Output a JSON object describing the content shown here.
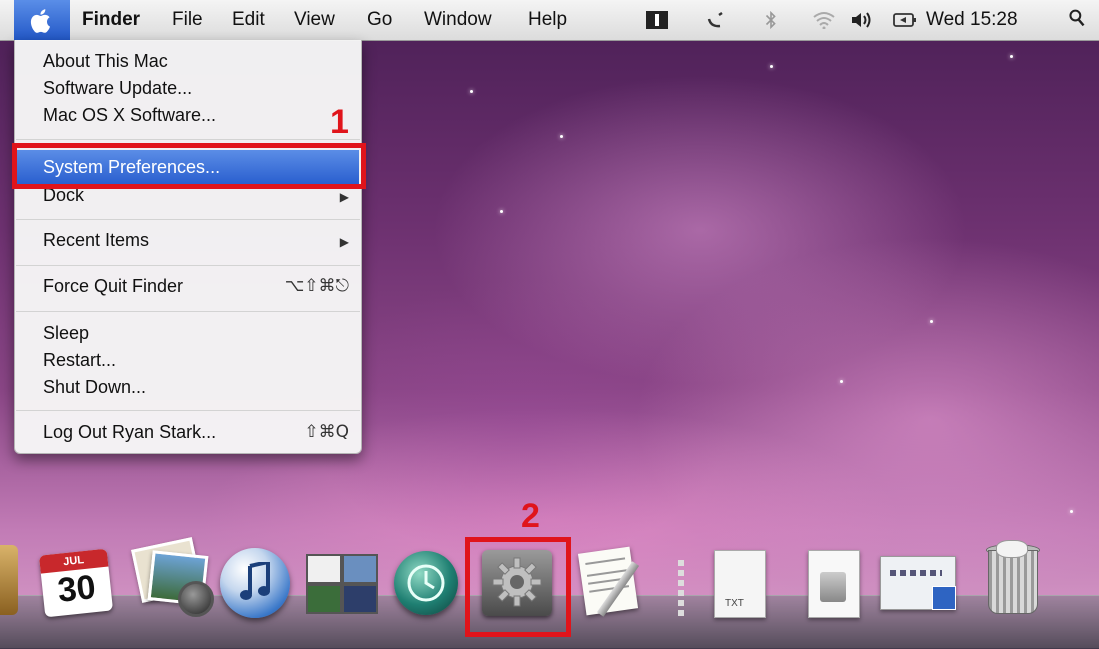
{
  "menubar": {
    "app_name": "Finder",
    "menus": [
      "File",
      "Edit",
      "View",
      "Go",
      "Window",
      "Help"
    ],
    "clock": "Wed 15:28",
    "status_icons": [
      "spaces-icon",
      "tether-icon",
      "bluetooth-icon",
      "wifi-icon",
      "volume-icon",
      "battery-icon",
      "spotlight-icon"
    ]
  },
  "apple_menu": {
    "about": "About This Mac",
    "software_update": "Software Update...",
    "mac_os_x_software": "Mac OS X Software...",
    "system_preferences": "System Preferences...",
    "dock": "Dock",
    "recent_items": "Recent Items",
    "force_quit": "Force Quit Finder",
    "force_quit_shortcut": "⌥⇧⌘⎋",
    "sleep": "Sleep",
    "restart": "Restart...",
    "shut_down": "Shut Down...",
    "log_out": "Log Out Ryan Stark...",
    "log_out_shortcut": "⇧⌘Q",
    "submenu_arrow": "▶"
  },
  "annotations": {
    "step1": "1",
    "step2": "2",
    "color": "#e0141b"
  },
  "dock": {
    "calendar_day": "30",
    "calendar_month": "JUL",
    "txt_label": "TXT",
    "items": [
      "ical-icon",
      "iphoto-icon",
      "itunes-icon",
      "spaces-icon",
      "time-machine-icon",
      "system-preferences-icon",
      "textedit-icon",
      "txt-document-icon",
      "document-icon",
      "preview-icon",
      "trash-icon"
    ]
  }
}
